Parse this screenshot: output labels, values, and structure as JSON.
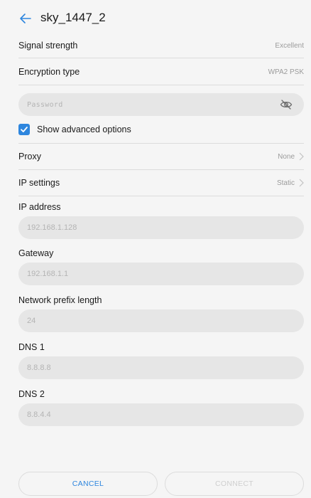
{
  "header": {
    "title": "sky_1447_2"
  },
  "rows": {
    "signal": {
      "label": "Signal strength",
      "value": "Excellent"
    },
    "encryption": {
      "label": "Encryption type",
      "value": "WPA2 PSK"
    }
  },
  "password": {
    "placeholder": "Password"
  },
  "advanced": {
    "label": "Show advanced options",
    "checked": true
  },
  "proxy": {
    "label": "Proxy",
    "value": "None"
  },
  "ip_settings": {
    "label": "IP settings",
    "value": "Static"
  },
  "fields": {
    "ip_address": {
      "label": "IP address",
      "value": "192.168.1.128"
    },
    "gateway": {
      "label": "Gateway",
      "value": "192.168.1.1"
    },
    "prefix": {
      "label": "Network prefix length",
      "value": "24"
    },
    "dns1": {
      "label": "DNS 1",
      "value": "8.8.8.8"
    },
    "dns2": {
      "label": "DNS 2",
      "value": "8.8.4.4"
    }
  },
  "buttons": {
    "cancel": "CANCEL",
    "connect": "CONNECT"
  },
  "colors": {
    "accent": "#2e86de",
    "field_bg": "#e6e6e6",
    "muted": "#9b9b9b"
  },
  "icons": {
    "back": "arrow-left-icon",
    "eye": "eye-off-icon",
    "chevron": "chevron-right-icon",
    "check": "checkmark-icon"
  }
}
